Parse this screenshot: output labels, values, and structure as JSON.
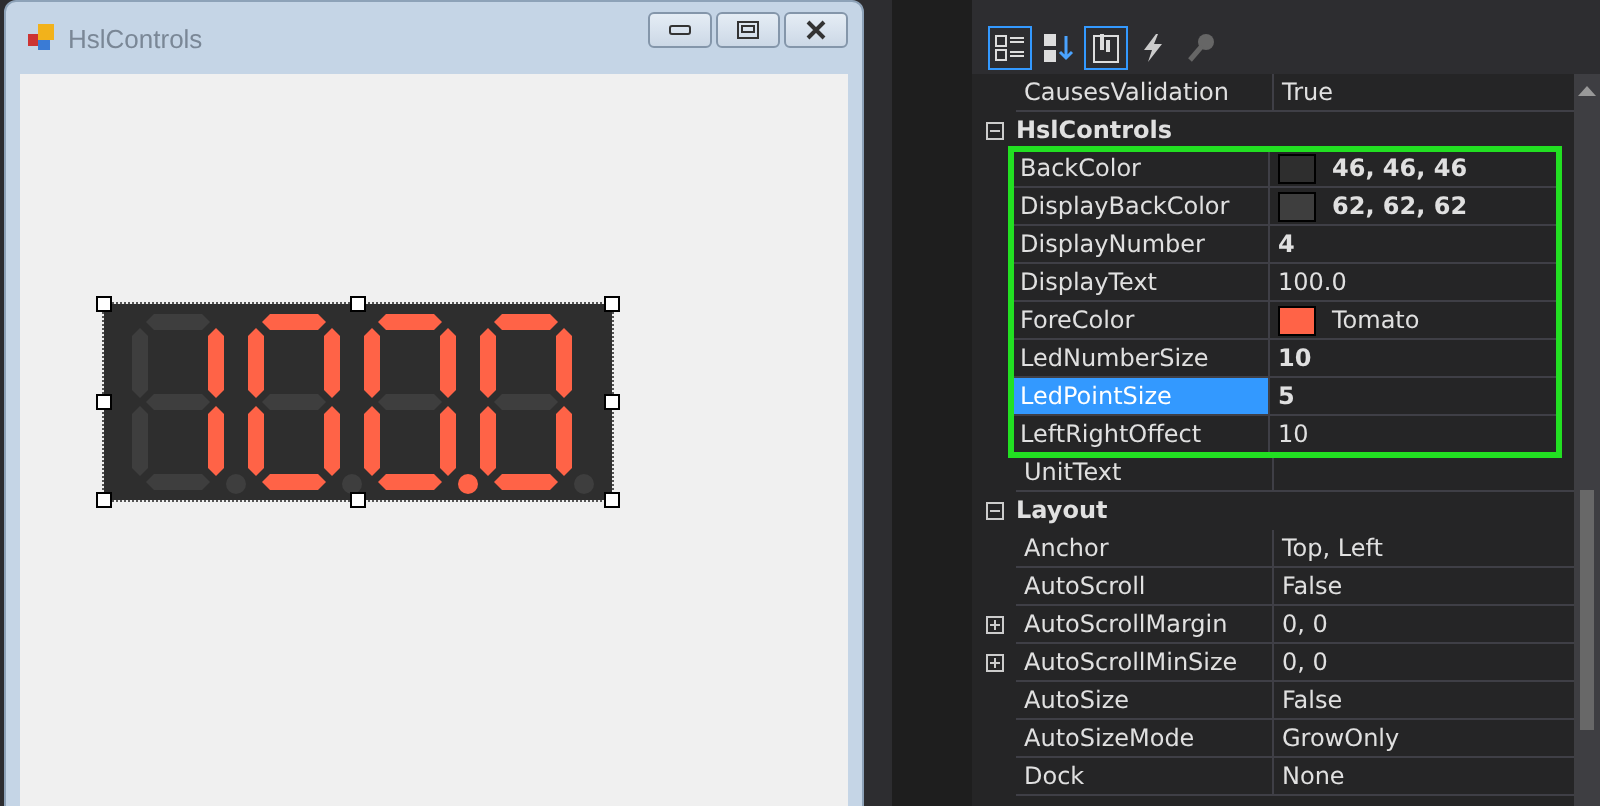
{
  "form": {
    "title": "HslControls"
  },
  "properties": {
    "toolbar": [
      {
        "kind": "categorized",
        "selected": true
      },
      {
        "kind": "alphabetical",
        "selected": false
      },
      {
        "kind": "properties",
        "selected": true
      },
      {
        "kind": "events",
        "selected": false
      },
      {
        "kind": "pages",
        "selected": false
      }
    ],
    "rows": [
      {
        "kind": "property",
        "name": "CausesValidation",
        "value": "True",
        "selected": false
      },
      {
        "kind": "category",
        "name": "HslControls",
        "expanded": true
      },
      {
        "kind": "highlight_group",
        "rows": [
          {
            "kind": "property",
            "name": "BackColor",
            "value": "46, 46, 46",
            "color": "#2e2e2e",
            "modified": true,
            "selected": false
          },
          {
            "kind": "property",
            "name": "DisplayBackColor",
            "value": "62, 62, 62",
            "color": "#3e3e3e",
            "modified": true,
            "selected": false
          },
          {
            "kind": "property",
            "name": "DisplayNumber",
            "value": "4",
            "modified": true,
            "selected": false
          },
          {
            "kind": "property",
            "name": "DisplayText",
            "value": "100.0",
            "modified": false,
            "selected": false
          },
          {
            "kind": "property",
            "name": "ForeColor",
            "value": "Tomato",
            "color": "#ff6347",
            "modified": false,
            "selected": false
          },
          {
            "kind": "property",
            "name": "LedNumberSize",
            "value": "10",
            "modified": true,
            "selected": false
          },
          {
            "kind": "property",
            "name": "LedPointSize",
            "value": "5",
            "modified": true,
            "selected": true
          },
          {
            "kind": "property",
            "name": "LeftRightOffect",
            "value": "10",
            "modified": false,
            "selected": false
          }
        ]
      },
      {
        "kind": "property",
        "name": "UnitText",
        "selected": false
      },
      {
        "kind": "category",
        "name": "Layout",
        "expanded": true
      },
      {
        "kind": "property",
        "name": "Anchor",
        "value": "Top, Left",
        "selected": false
      },
      {
        "kind": "property",
        "name": "AutoScroll",
        "value": "False",
        "selected": false
      },
      {
        "kind": "property",
        "name": "AutoScrollMargin",
        "value": "0, 0",
        "expanded": false,
        "selected": false
      },
      {
        "kind": "property",
        "name": "AutoScrollMinSize",
        "value": "0, 0",
        "expanded": false,
        "selected": false
      },
      {
        "kind": "property",
        "name": "AutoSize",
        "value": "False",
        "selected": false
      },
      {
        "kind": "property",
        "name": "AutoSizeMode",
        "value": "GrowOnly",
        "selected": false
      },
      {
        "kind": "property",
        "name": "Dock",
        "value": "None",
        "selected": false
      }
    ]
  }
}
